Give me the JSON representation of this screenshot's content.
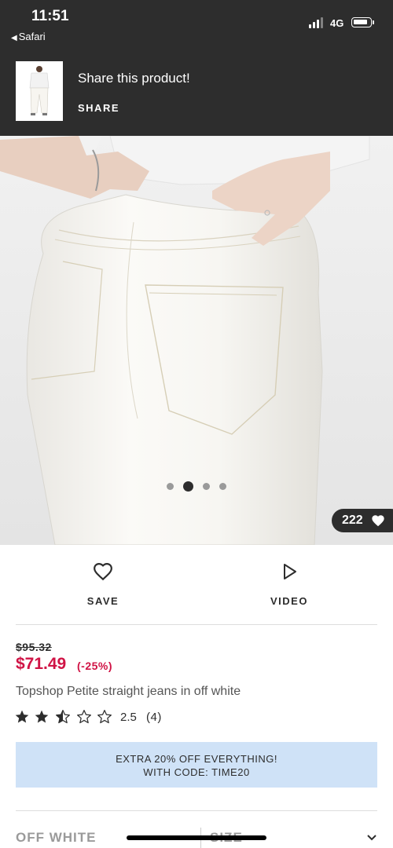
{
  "status_bar": {
    "time": "11:51",
    "back_app": "Safari",
    "network": "4G"
  },
  "share_banner": {
    "title": "Share this product!",
    "action": "SHARE"
  },
  "gallery": {
    "image_count": 4,
    "active_index": 1,
    "likes": "222"
  },
  "actions": {
    "save": "SAVE",
    "video": "VIDEO"
  },
  "product": {
    "old_price": "$95.32",
    "price": "$71.49",
    "discount": "(-25%)",
    "title": "Topshop Petite straight jeans in off white",
    "rating_stars": 2.5,
    "rating_value": "2.5",
    "rating_count": "(4)"
  },
  "promo": {
    "line1": "EXTRA 20% OFF EVERYTHING!",
    "line2": "WITH CODE: TIME20"
  },
  "selectors": {
    "colour": "OFF WHITE",
    "size": "SIZE"
  },
  "colors": {
    "dark": "#2d2d2d",
    "sale_red": "#d01345",
    "promo_bg": "#cfe2f7"
  }
}
